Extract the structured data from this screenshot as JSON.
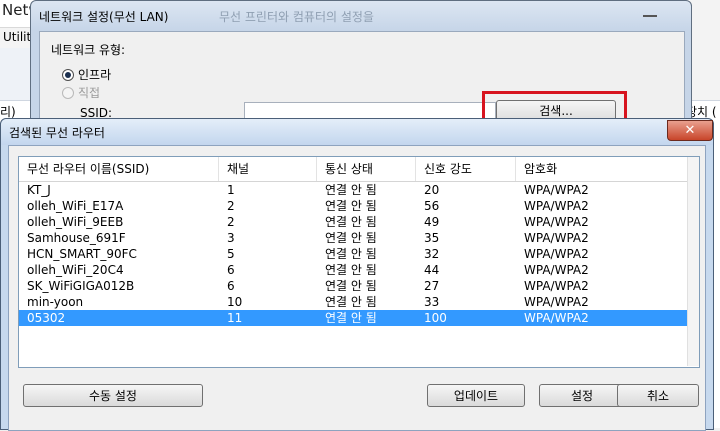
{
  "background_app": {
    "title": "Netw",
    "menu_item": "Utility",
    "row_label": "리)",
    "right_label": "장치 ("
  },
  "network_dialog": {
    "title": "네트워크 설정(무선 LAN)",
    "faded_text": "무선 프린터와 컴퓨터의 설정을",
    "network_type_label": "네트워크 유형:",
    "options": [
      {
        "label": "인프라",
        "selected": true,
        "enabled": true
      },
      {
        "label": "직접",
        "selected": false,
        "enabled": false
      }
    ],
    "ssid_label": "SSID:",
    "search_button": "검색..."
  },
  "router_dialog": {
    "title": "검색된 무선 라우터",
    "close_icon": "close-icon",
    "columns": [
      "무선 라우터 이름(SSID)",
      "채널",
      "통신 상태",
      "신호 강도",
      "암호화"
    ],
    "rows": [
      [
        "KT_J",
        "1",
        "연결 안 됨",
        "20",
        "WPA/WPA2"
      ],
      [
        "olleh_WiFi_E17A",
        "2",
        "연결 안 됨",
        "56",
        "WPA/WPA2"
      ],
      [
        "olleh_WiFi_9EEB",
        "2",
        "연결 안 됨",
        "49",
        "WPA/WPA2"
      ],
      [
        "Samhouse_691F",
        "3",
        "연결 안 됨",
        "35",
        "WPA/WPA2"
      ],
      [
        "HCN_SMART_90FC",
        "5",
        "연결 안 됨",
        "32",
        "WPA/WPA2"
      ],
      [
        "olleh_WiFi_20C4",
        "6",
        "연결 안 됨",
        "44",
        "WPA/WPA2"
      ],
      [
        "SK_WiFiGIGA012B",
        "6",
        "연결 안 됨",
        "27",
        "WPA/WPA2"
      ],
      [
        "min-yoon",
        "10",
        "연결 안 됨",
        "33",
        "WPA/WPA2"
      ],
      [
        "05302",
        "11",
        "연결 안 됨",
        "100",
        "WPA/WPA2"
      ]
    ],
    "selected_row": 8,
    "buttons": {
      "manual": "수동 설정",
      "update": "업데이트",
      "settings": "설정",
      "cancel": "취소"
    }
  },
  "colors": {
    "selection": "#3399ff",
    "highlight_box": "#d7141f"
  }
}
